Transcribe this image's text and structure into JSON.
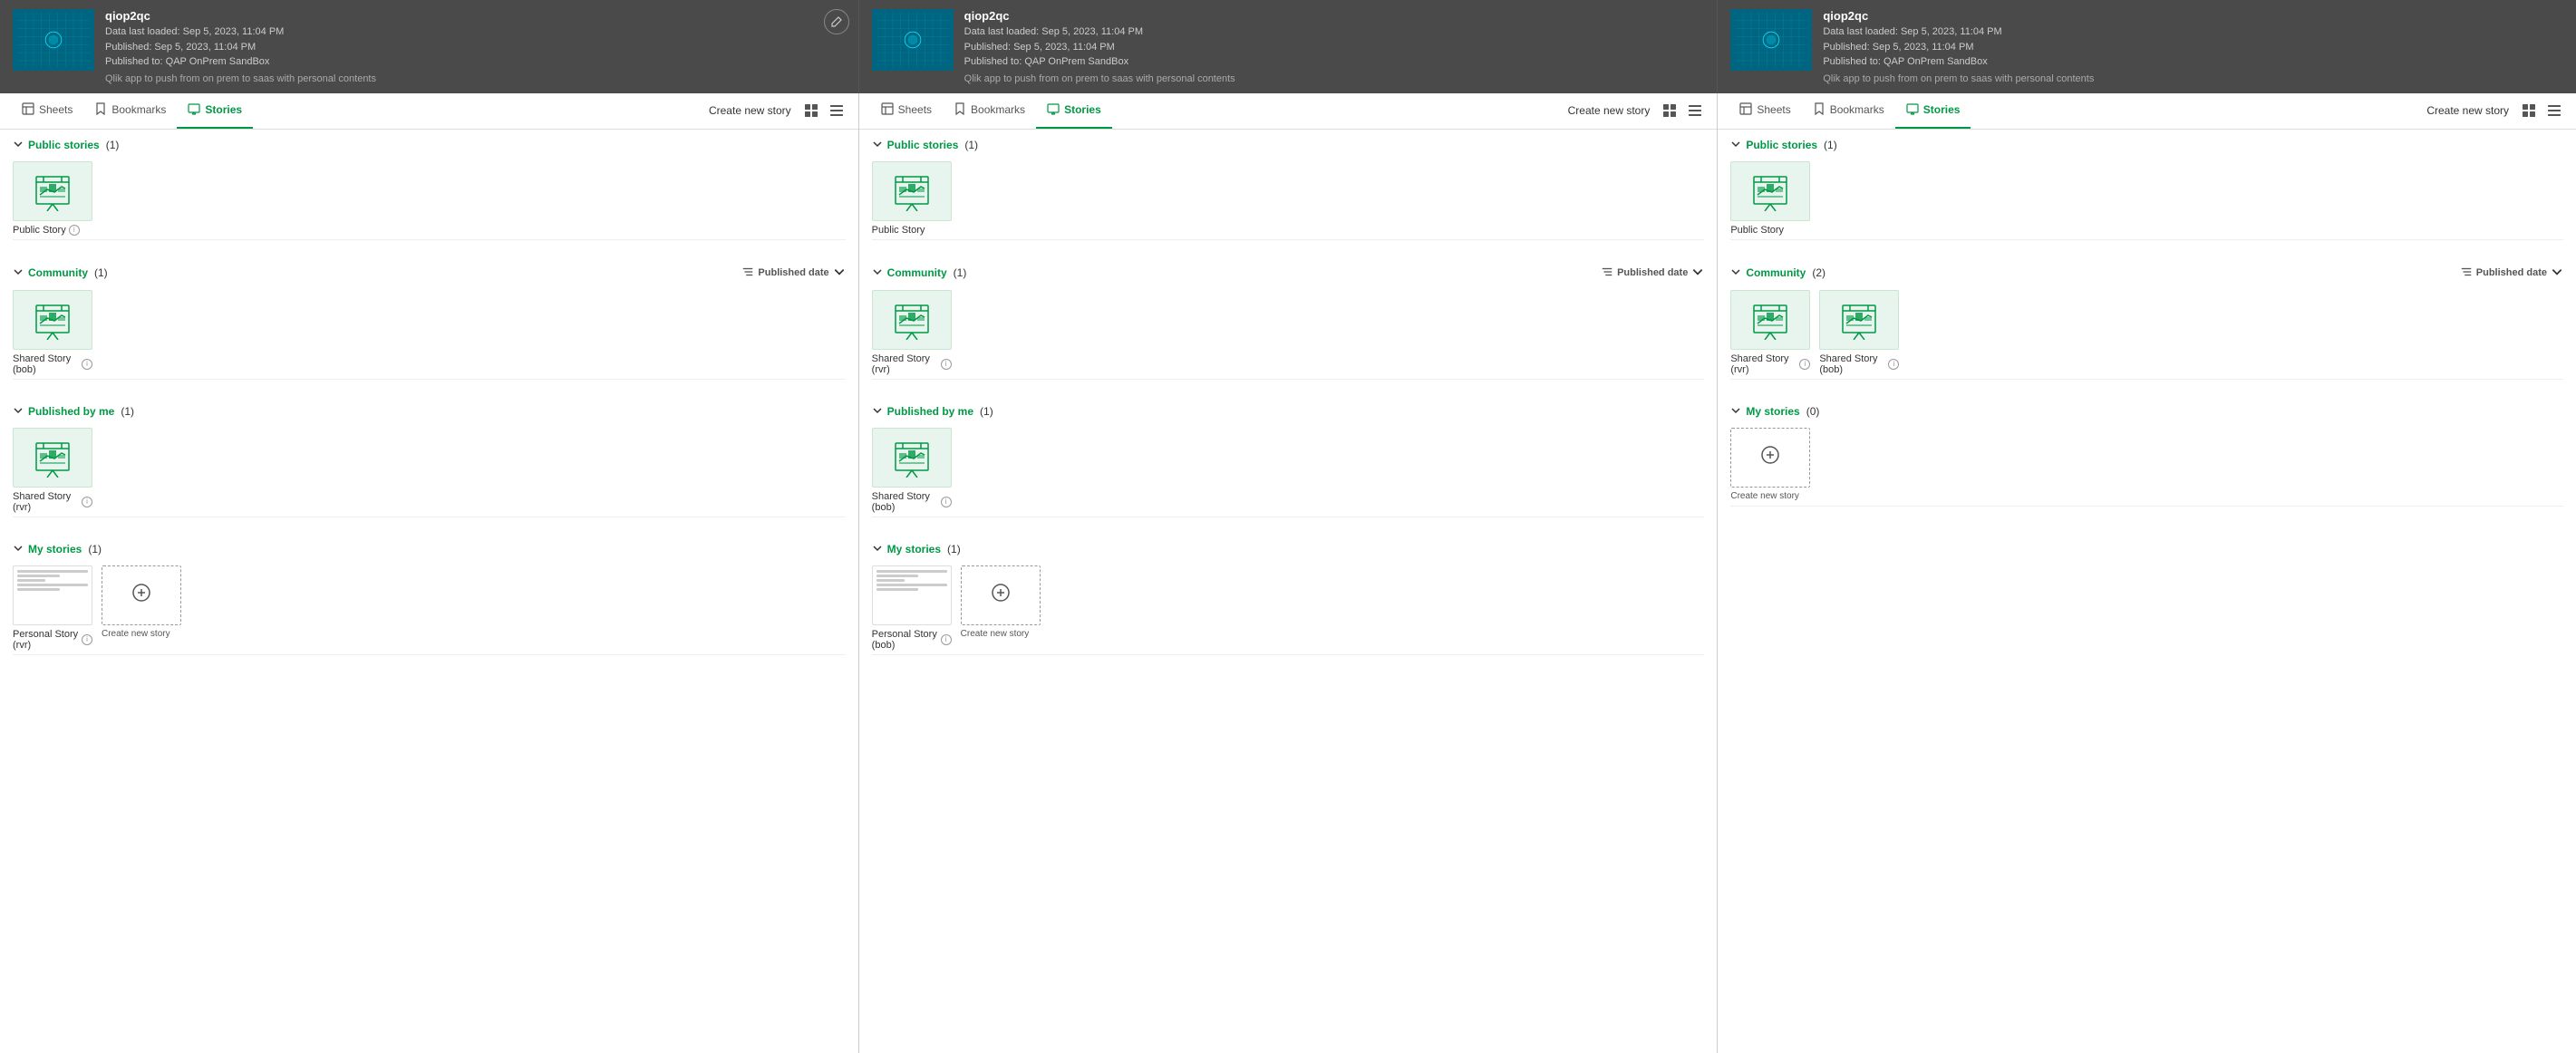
{
  "panels": [
    {
      "id": "panel-1",
      "app": {
        "name": "qiop2qc",
        "meta_line1": "Data last loaded: Sep 5, 2023, 11:04 PM",
        "meta_line2": "Published: Sep 5, 2023, 11:04 PM",
        "meta_line3": "Published to: QAP OnPrem SandBox",
        "description": "Qlik app to push from on prem to saas with personal contents",
        "has_edit": true
      },
      "tabs": [
        "Sheets",
        "Bookmarks",
        "Stories"
      ],
      "active_tab": "Stories",
      "create_new_label": "Create new story",
      "sections": [
        {
          "id": "public",
          "label": "Public stories",
          "count": 1,
          "has_sort": false,
          "cards": [
            {
              "type": "story",
              "label": "Public Story",
              "has_info": true
            }
          ]
        },
        {
          "id": "community",
          "label": "Community",
          "count": 1,
          "has_sort": true,
          "sort_label": "Published date",
          "cards": [
            {
              "type": "story",
              "label": "Shared Story (bob)",
              "has_info": true
            }
          ]
        },
        {
          "id": "published",
          "label": "Published by me",
          "count": 1,
          "has_sort": false,
          "cards": [
            {
              "type": "story",
              "label": "Shared Story (rvr)",
              "has_info": true
            }
          ]
        },
        {
          "id": "mystories",
          "label": "My stories",
          "count": 1,
          "has_sort": false,
          "cards": [
            {
              "type": "personal",
              "label": "Personal Story (rvr)",
              "has_info": true
            },
            {
              "type": "create",
              "label": "Create new story"
            }
          ]
        }
      ]
    },
    {
      "id": "panel-2",
      "app": {
        "name": "qiop2qc",
        "meta_line1": "Data last loaded: Sep 5, 2023, 11:04 PM",
        "meta_line2": "Published: Sep 5, 2023, 11:04 PM",
        "meta_line3": "Published to: QAP OnPrem SandBox",
        "description": "Qlik app to push from on prem to saas with personal contents",
        "has_edit": false
      },
      "tabs": [
        "Sheets",
        "Bookmarks",
        "Stories"
      ],
      "active_tab": "Stories",
      "create_new_label": "Create new story",
      "sections": [
        {
          "id": "public",
          "label": "Public stories",
          "count": 1,
          "has_sort": false,
          "cards": [
            {
              "type": "story",
              "label": "Public Story",
              "has_info": false
            }
          ]
        },
        {
          "id": "community",
          "label": "Community",
          "count": 1,
          "has_sort": true,
          "sort_label": "Published date",
          "cards": [
            {
              "type": "story",
              "label": "Shared Story (rvr)",
              "has_info": true
            }
          ]
        },
        {
          "id": "published",
          "label": "Published by me",
          "count": 1,
          "has_sort": false,
          "cards": [
            {
              "type": "story",
              "label": "Shared Story (bob)",
              "has_info": true
            }
          ]
        },
        {
          "id": "mystories",
          "label": "My stories",
          "count": 1,
          "has_sort": false,
          "cards": [
            {
              "type": "personal",
              "label": "Personal Story (bob)",
              "has_info": true
            },
            {
              "type": "create",
              "label": "Create new story"
            }
          ]
        }
      ]
    },
    {
      "id": "panel-3",
      "app": {
        "name": "qiop2qc",
        "meta_line1": "Data last loaded: Sep 5, 2023, 11:04 PM",
        "meta_line2": "Published: Sep 5, 2023, 11:04 PM",
        "meta_line3": "Published to: QAP OnPrem SandBox",
        "description": "Qlik app to push from on prem to saas with personal contents",
        "has_edit": false
      },
      "tabs": [
        "Sheets",
        "Bookmarks",
        "Stories"
      ],
      "active_tab": "Stories",
      "create_new_label": "Create new story",
      "sections": [
        {
          "id": "public",
          "label": "Public stories",
          "count": 1,
          "has_sort": false,
          "cards": [
            {
              "type": "story",
              "label": "Public Story",
              "has_info": false
            }
          ]
        },
        {
          "id": "community",
          "label": "Community",
          "count": 2,
          "has_sort": true,
          "sort_label": "Published date",
          "cards": [
            {
              "type": "story",
              "label": "Shared Story (rvr)",
              "has_info": true
            },
            {
              "type": "story",
              "label": "Shared Story (bob)",
              "has_info": true
            }
          ]
        },
        {
          "id": "mystories",
          "label": "My stories",
          "count": 0,
          "has_sort": false,
          "cards": [
            {
              "type": "create",
              "label": "Create new story"
            }
          ]
        }
      ]
    }
  ]
}
